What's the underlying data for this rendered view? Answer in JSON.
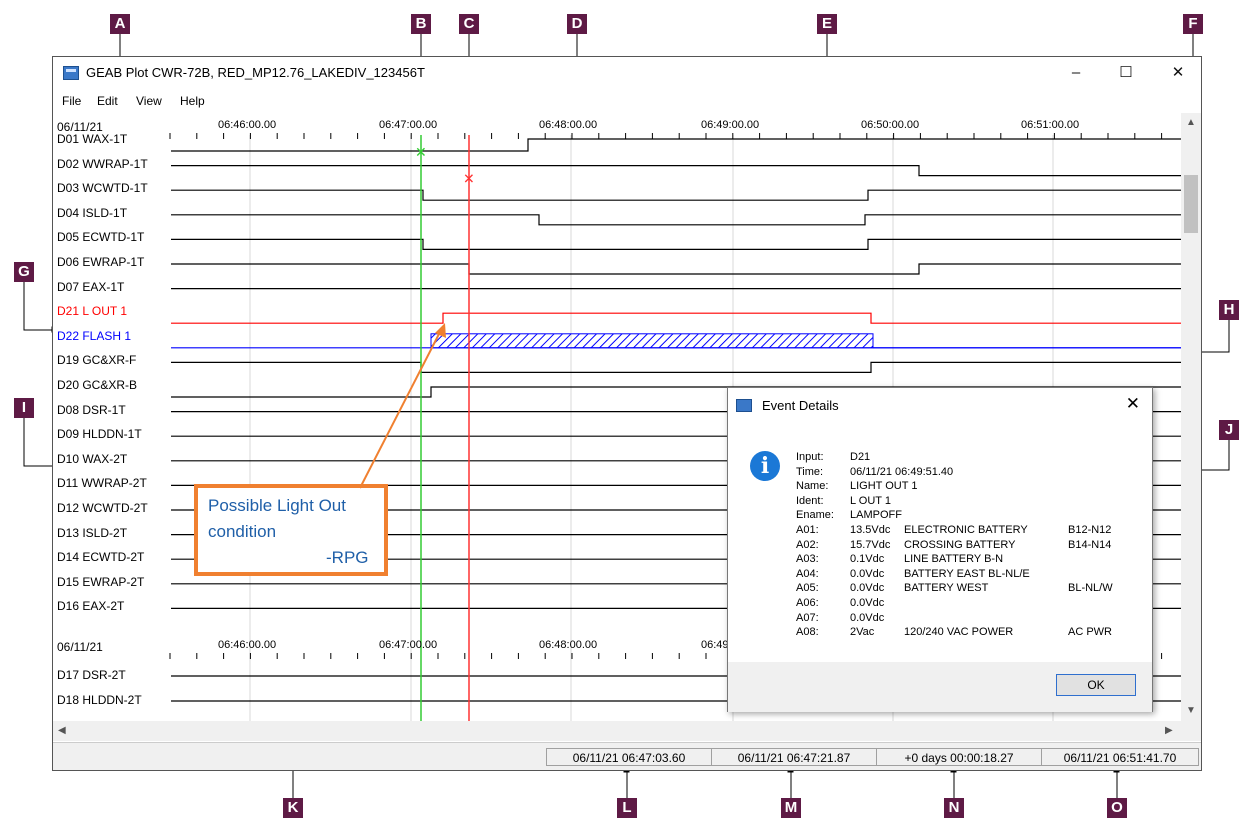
{
  "window": {
    "title": "GEAB Plot CWR-72B, RED_MP12.76_LAKEDIV_123456T",
    "minimize": "–",
    "maximize": "☐",
    "close": "✕"
  },
  "menu": [
    "File",
    "Edit",
    "View",
    "Help"
  ],
  "plot": {
    "date": "06/11/21",
    "time_labels": [
      "06:46:00.00",
      "06:47:00.00",
      "06:48:00.00",
      "06:49:00.00",
      "06:50:00.00",
      "06:51:00.00"
    ],
    "lower_date": "06/11/21",
    "lower_time_labels": [
      "06:46:00.00",
      "06:47:00.00",
      "06:48:00.00",
      "06:49"
    ],
    "channels": [
      {
        "label": "D01 WAX-1T",
        "color": "#000000"
      },
      {
        "label": "D02 WWRAP-1T",
        "color": "#000000"
      },
      {
        "label": "D03 WCWTD-1T",
        "color": "#000000"
      },
      {
        "label": "D04 ISLD-1T",
        "color": "#000000"
      },
      {
        "label": "D05 ECWTD-1T",
        "color": "#000000"
      },
      {
        "label": "D06 EWRAP-1T",
        "color": "#000000"
      },
      {
        "label": "D07 EAX-1T",
        "color": "#000000"
      },
      {
        "label": "D21 L OUT 1",
        "color": "#ff0000"
      },
      {
        "label": "D22 FLASH 1",
        "color": "#0000ff"
      },
      {
        "label": "D19 GC&XR-F",
        "color": "#000000"
      },
      {
        "label": "D20 GC&XR-B",
        "color": "#000000"
      },
      {
        "label": "D08 DSR-1T",
        "color": "#000000"
      },
      {
        "label": "D09 HLDDN-1T",
        "color": "#000000"
      },
      {
        "label": "D10 WAX-2T",
        "color": "#000000"
      },
      {
        "label": "D11 WWRAP-2T",
        "color": "#000000"
      },
      {
        "label": "D12 WCWTD-2T",
        "color": "#000000"
      },
      {
        "label": "D13 ISLD-2T",
        "color": "#000000"
      },
      {
        "label": "D14 ECWTD-2T",
        "color": "#000000"
      },
      {
        "label": "D15 EWRAP-2T",
        "color": "#000000"
      },
      {
        "label": "D16 EAX-2T",
        "color": "#000000"
      }
    ],
    "lower_channels": [
      {
        "label": "D17 DSR-2T",
        "color": "#000000"
      },
      {
        "label": "D18 HLDDN-2T",
        "color": "#000000"
      }
    ],
    "cursor_colors": {
      "green": "#33cc33",
      "red": "#ff3333"
    }
  },
  "annotation": {
    "line1": "Possible Light Out",
    "line2": "condition",
    "line3": "-RPG"
  },
  "dialog": {
    "title": "Event Details",
    "close": "✕",
    "rows": [
      [
        "Input:",
        "D21",
        "",
        ""
      ],
      [
        "Time:",
        "06/11/21 06:49:51.40",
        "",
        ""
      ],
      [
        "Name:",
        "LIGHT OUT 1",
        "",
        ""
      ],
      [
        "Ident:",
        "L OUT 1",
        "",
        ""
      ],
      [
        "Ename:",
        "LAMPOFF",
        "",
        ""
      ],
      [
        "A01:",
        "13.5Vdc",
        "ELECTRONIC BATTERY",
        "B12-N12"
      ],
      [
        "A02:",
        "15.7Vdc",
        "CROSSING BATTERY",
        "B14-N14"
      ],
      [
        "A03:",
        "0.1Vdc",
        "LINE BATTERY      B-N",
        ""
      ],
      [
        "A04:",
        "0.0Vdc",
        "BATTERY EAST      BL-NL/E",
        ""
      ],
      [
        "A05:",
        "0.0Vdc",
        "BATTERY WEST",
        "BL-NL/W"
      ],
      [
        "A06:",
        "0.0Vdc",
        "",
        ""
      ],
      [
        "A07:",
        "0.0Vdc",
        "",
        ""
      ],
      [
        "A08:",
        "2Vac",
        "120/240 VAC POWER",
        "AC PWR"
      ]
    ],
    "ok": "OK"
  },
  "status": {
    "t1": "06/11/21 06:47:03.60",
    "t2": "06/11/21 06:47:21.87",
    "delta": "+0 days 00:00:18.27",
    "t3": "06/11/21 06:51:41.70"
  },
  "callouts": [
    "A",
    "B",
    "C",
    "D",
    "E",
    "F",
    "G",
    "H",
    "I",
    "J",
    "K",
    "L",
    "M",
    "N",
    "O"
  ],
  "callout_color": "#5e1a45",
  "annotation_color": "#f08030"
}
